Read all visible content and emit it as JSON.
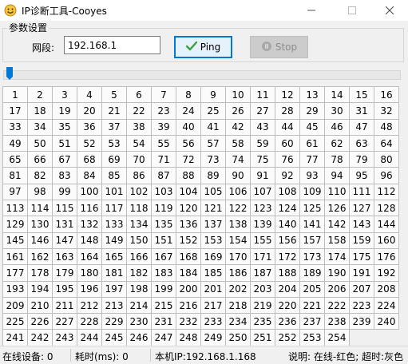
{
  "window": {
    "title": "IP诊断工具-Cooyes",
    "icon": "smiley-icon",
    "controls": [
      "minimize-icon",
      "maximize-icon",
      "close-icon"
    ]
  },
  "settings": {
    "group_label": "参数设置",
    "segment_label": "网段:",
    "segment_value": "192.168.1",
    "ping_label": "Ping",
    "stop_label": "Stop"
  },
  "slider": {
    "value_fraction": 0.0
  },
  "grid": {
    "columns": 16,
    "cells": [
      "1",
      "2",
      "3",
      "4",
      "5",
      "6",
      "7",
      "8",
      "9",
      "10",
      "11",
      "12",
      "13",
      "14",
      "15",
      "16",
      "17",
      "18",
      "19",
      "20",
      "21",
      "22",
      "23",
      "24",
      "25",
      "26",
      "27",
      "28",
      "29",
      "30",
      "31",
      "32",
      "33",
      "34",
      "35",
      "36",
      "37",
      "38",
      "39",
      "40",
      "41",
      "42",
      "43",
      "44",
      "45",
      "46",
      "47",
      "48",
      "49",
      "50",
      "51",
      "52",
      "53",
      "54",
      "55",
      "56",
      "57",
      "58",
      "59",
      "60",
      "61",
      "62",
      "63",
      "64",
      "65",
      "66",
      "67",
      "68",
      "69",
      "70",
      "71",
      "72",
      "73",
      "74",
      "75",
      "76",
      "77",
      "78",
      "79",
      "80",
      "81",
      "82",
      "83",
      "84",
      "85",
      "86",
      "87",
      "88",
      "89",
      "90",
      "91",
      "92",
      "93",
      "94",
      "95",
      "96",
      "97",
      "98",
      "99",
      "100",
      "101",
      "102",
      "103",
      "104",
      "105",
      "106",
      "107",
      "108",
      "109",
      "110",
      "111",
      "112",
      "113",
      "114",
      "115",
      "116",
      "117",
      "118",
      "119",
      "120",
      "121",
      "122",
      "123",
      "124",
      "125",
      "126",
      "127",
      "128",
      "129",
      "130",
      "131",
      "132",
      "133",
      "134",
      "135",
      "136",
      "137",
      "138",
      "139",
      "140",
      "141",
      "142",
      "143",
      "144",
      "145",
      "146",
      "147",
      "148",
      "149",
      "150",
      "151",
      "152",
      "153",
      "154",
      "155",
      "156",
      "157",
      "158",
      "159",
      "160",
      "161",
      "162",
      "163",
      "164",
      "165",
      "166",
      "167",
      "168",
      "169",
      "170",
      "171",
      "172",
      "173",
      "174",
      "175",
      "176",
      "177",
      "178",
      "179",
      "180",
      "181",
      "182",
      "183",
      "184",
      "185",
      "186",
      "187",
      "188",
      "189",
      "190",
      "191",
      "192",
      "193",
      "194",
      "195",
      "196",
      "197",
      "198",
      "199",
      "200",
      "201",
      "202",
      "203",
      "204",
      "205",
      "206",
      "207",
      "208",
      "209",
      "210",
      "211",
      "212",
      "213",
      "214",
      "215",
      "216",
      "217",
      "218",
      "219",
      "220",
      "221",
      "222",
      "223",
      "224",
      "225",
      "226",
      "227",
      "228",
      "229",
      "230",
      "231",
      "232",
      "233",
      "234",
      "235",
      "236",
      "237",
      "238",
      "239",
      "240",
      "241",
      "242",
      "243",
      "244",
      "245",
      "246",
      "247",
      "248",
      "249",
      "250",
      "251",
      "252",
      "253",
      "254"
    ]
  },
  "status": {
    "online_devices": "在线设备:  0",
    "elapsed": "耗时(ms):  0",
    "local_ip": "本机IP:192.168.1.168",
    "legend": "说明: 在线-红色; 超时:灰色"
  },
  "colors": {
    "accent": "#0078d7",
    "cell_background": "#fbfbfb",
    "cell_border": "#bdbdbd",
    "ping_check": "#3c9e3c"
  }
}
